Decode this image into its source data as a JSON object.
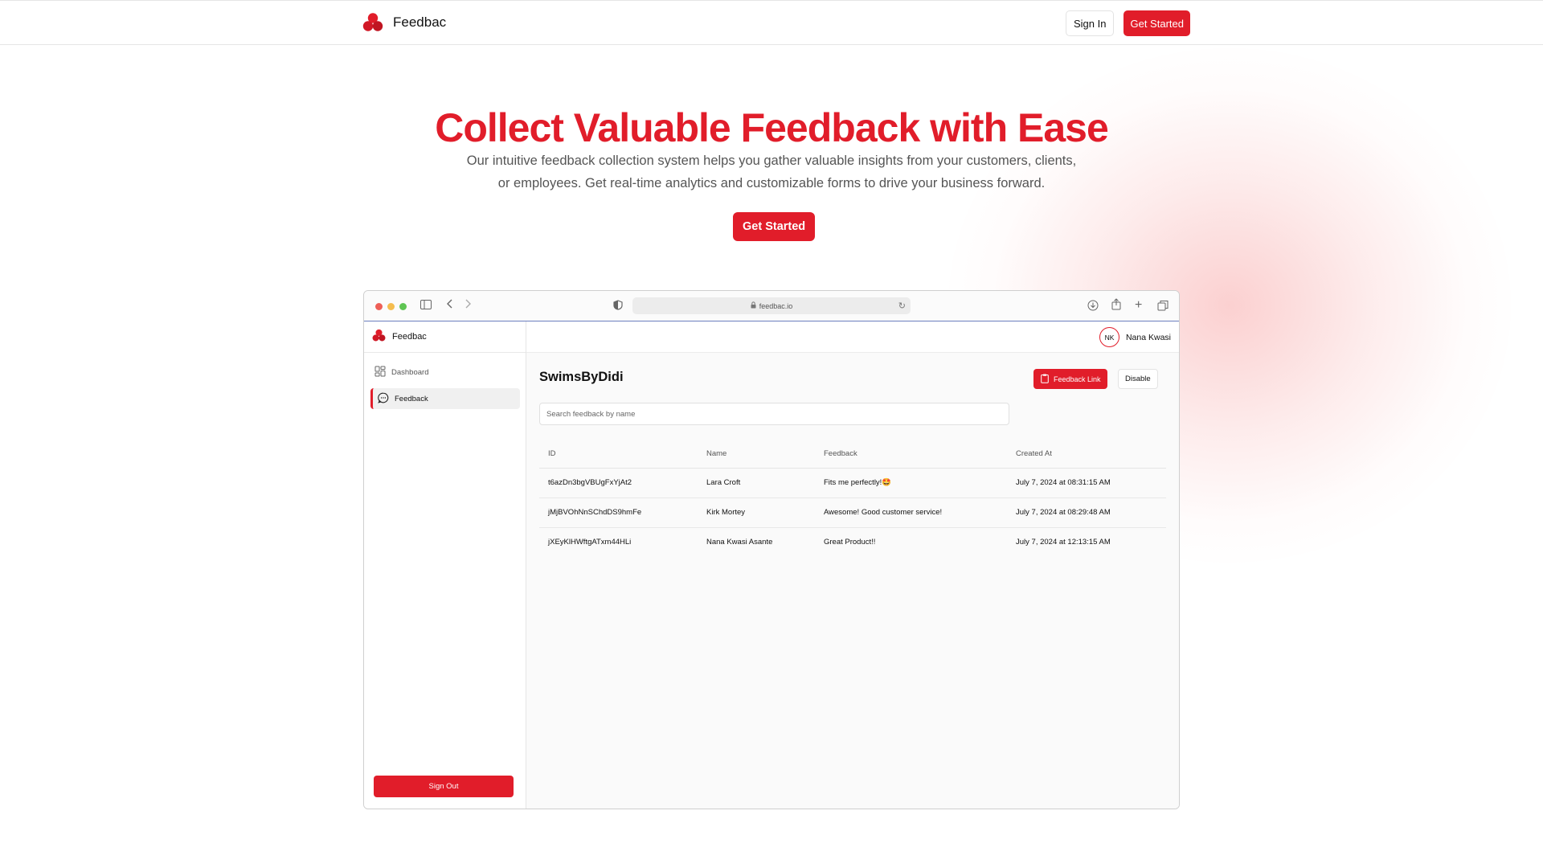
{
  "colors": {
    "brand_red": "#e11d2a",
    "window_close": "#ee5f57",
    "window_minimize": "#f5bd4f",
    "window_zoom": "#5fc553"
  },
  "nav": {
    "brand": "Feedbac",
    "sign_in": "Sign In",
    "get_started": "Get Started"
  },
  "hero": {
    "title": "Collect Valuable Feedback with Ease",
    "subtitle": "Our intuitive feedback collection system helps you gather valuable insights from your customers, clients, or employees. Get real-time analytics and customizable forms to drive your business forward.",
    "cta": "Get Started"
  },
  "browser": {
    "url": "feedbac.io"
  },
  "app": {
    "brand": "Feedbac",
    "sidebar": {
      "items": [
        {
          "label": "Dashboard",
          "icon": "dashboard-icon",
          "active": false
        },
        {
          "label": "Feedback",
          "icon": "message-icon",
          "active": true
        }
      ],
      "sign_out": "Sign Out"
    },
    "user": {
      "initials": "NK",
      "name": "Nana Kwasi"
    },
    "page_title": "SwimsByDidi",
    "feedback_link_label": "Feedback Link",
    "disable_label": "Disable",
    "search_placeholder": "Search feedback by name",
    "table": {
      "columns": [
        "ID",
        "Name",
        "Feedback",
        "Created At"
      ],
      "rows": [
        [
          "t6azDn3bgVBUgFxYjAt2",
          "Lara Croft",
          "Fits me perfectly!🤩",
          "July 7, 2024 at 08:31:15 AM"
        ],
        [
          "jMjBVOhNnSChdDS9hmFe",
          "Kirk Mortey",
          "Awesome! Good customer service!",
          "July 7, 2024 at 08:29:48 AM"
        ],
        [
          "jXEyKlHWftgATxm44HLi",
          "Nana Kwasi Asante",
          "Great Product!!",
          "July 7, 2024 at 12:13:15 AM"
        ]
      ]
    }
  }
}
